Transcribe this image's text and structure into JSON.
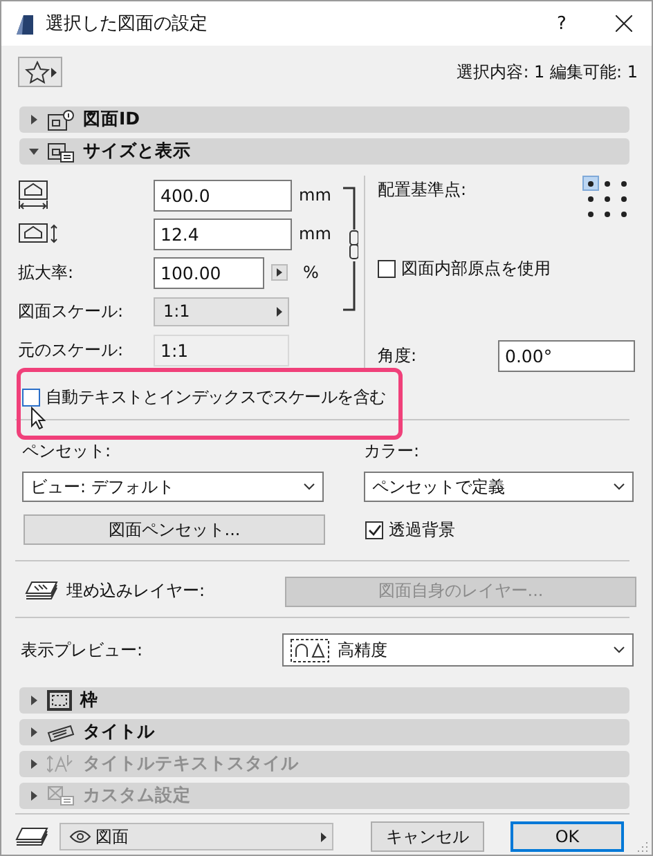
{
  "window": {
    "title": "選択した図面の設定",
    "help": "?"
  },
  "favorites": {
    "selection_info": "選択内容: 1 編集可能: 1"
  },
  "sections_top": [
    {
      "kind": "id",
      "label": "図面ID",
      "expanded": false,
      "disabled": false
    },
    {
      "kind": "size",
      "label": "サイズと表示",
      "expanded": true,
      "disabled": false
    }
  ],
  "size": {
    "width": {
      "value": "400.0",
      "unit": "mm"
    },
    "height": {
      "value": "12.4",
      "unit": "mm"
    },
    "zoom": {
      "label": "拡大率:",
      "value": "100.00",
      "unit": "%"
    },
    "drawing_scale": {
      "label": "図面スケール:",
      "value": "1:1"
    },
    "original_scale": {
      "label": "元のスケール:",
      "value": "1:1"
    },
    "anchor": {
      "label": "配置基準点:",
      "points": [
        {
          "selected": true
        },
        {
          "selected": false
        },
        {
          "selected": false
        },
        {
          "selected": false
        },
        {
          "selected": false
        },
        {
          "selected": false
        },
        {
          "selected": false
        },
        {
          "selected": false
        },
        {
          "selected": false
        }
      ]
    },
    "use_origin": {
      "label": "図面内部原点を使用",
      "checked": false
    },
    "angle": {
      "label": "角度:",
      "value": "0.00°"
    },
    "include_scale": {
      "label": "自動テキストとインデックスでスケールを含む",
      "checked": false,
      "highlighted": true
    }
  },
  "pens": {
    "pen_set_label": "ペンセット:",
    "pen_set_value": "ビュー: デフォルト",
    "color_label": "カラー:",
    "color_value": "ペンセットで定義",
    "pen_button": "図面ペンセット...",
    "transparent": {
      "label": "透過背景",
      "checked": true
    }
  },
  "layer": {
    "label": "埋め込みレイヤー:",
    "button": "図面自身のレイヤー...",
    "disabled": true
  },
  "preview": {
    "label": "表示プレビュー:",
    "value": "高精度"
  },
  "sections_bottom": [
    {
      "kind": "frame",
      "label": "枠",
      "expanded": false,
      "disabled": false
    },
    {
      "kind": "title",
      "label": "タイトル",
      "expanded": false,
      "disabled": false
    },
    {
      "kind": "textstyle",
      "label": "タイトルテキストスタイル",
      "expanded": false,
      "disabled": true
    },
    {
      "kind": "custom",
      "label": "カスタム設定",
      "expanded": false,
      "disabled": true
    }
  ],
  "footer": {
    "view": "図面",
    "buttons": [
      {
        "label": "キャンセル",
        "default": false
      },
      {
        "label": "OK",
        "default": true
      }
    ]
  }
}
